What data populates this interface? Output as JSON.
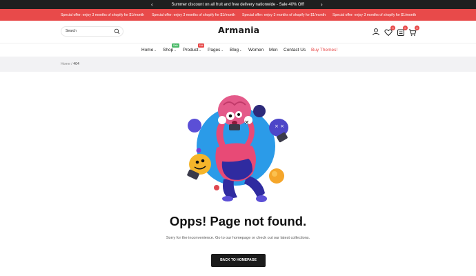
{
  "topbar": {
    "message": "Summer discount on all fruit and free delivery nationwide - Sale 40% Off!",
    "prev_icon": "chevron-left-icon",
    "next_icon": "chevron-right-icon"
  },
  "promo": {
    "items": [
      "Special offer: enjoy 3 months of shopify for $1/month",
      "Special offer: enjoy 3 months of shopify for $1/month",
      "Special offer: enjoy 3 months of shopify for $1/month",
      "Special offer: enjoy 3 months of shopify for $1/month"
    ]
  },
  "header": {
    "search_placeholder": "Search",
    "logo": "Armania",
    "wishlist_count": "0",
    "compare_count": "0",
    "cart_count": "0",
    "icons": [
      "search-icon",
      "user-icon",
      "heart-icon",
      "compare-icon",
      "cart-icon"
    ]
  },
  "nav": {
    "items": [
      {
        "label": "Home",
        "has_caret": true
      },
      {
        "label": "Shop",
        "has_caret": true,
        "tag": "Sale"
      },
      {
        "label": "Product",
        "has_caret": true,
        "tag": "Hot"
      },
      {
        "label": "Pages",
        "has_caret": true
      },
      {
        "label": "Blog",
        "has_caret": true
      },
      {
        "label": "Women",
        "has_caret": false
      },
      {
        "label": "Men",
        "has_caret": false
      },
      {
        "label": "Contact Us",
        "has_caret": false
      },
      {
        "label": "Buy Themes!",
        "has_caret": false
      }
    ],
    "caret": "⌄"
  },
  "breadcrumb": {
    "home": "Home",
    "separator": "/",
    "current": "404"
  },
  "main": {
    "title": "Opps! Page not found.",
    "subtitle": "Sorry for the inconvenience. Go to our homepage or check out our latest collections.",
    "button": "BACK TO HOMEPAGE"
  },
  "colors": {
    "accent": "#e84a4a",
    "dark": "#1b1b1b",
    "sale": "#4cbb6a",
    "illustration_blue": "#2b9be8"
  }
}
